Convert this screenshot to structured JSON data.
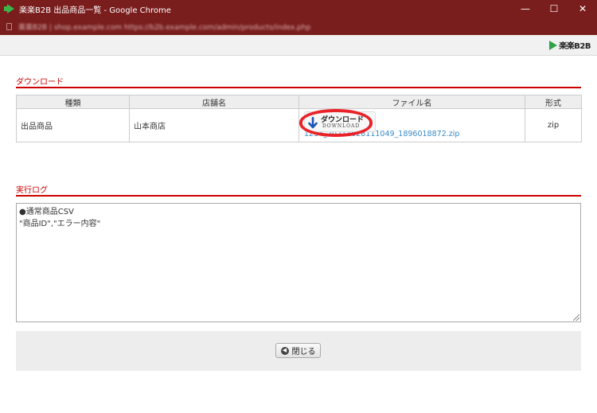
{
  "window": {
    "title": "楽楽B2B 出品商品一覧 - Google Chrome",
    "controls": {
      "minimize": "—",
      "maximize": "☐",
      "close": "✕"
    }
  },
  "addressbar": {
    "url": "楽楽B2B | shop.example.com   https://b2b.example.com/admin/products/index.php"
  },
  "brand": {
    "logo_text": "楽楽B2B"
  },
  "download_section": {
    "title": "ダウンロード",
    "columns": [
      "種類",
      "店舗名",
      "ファイル名",
      "形式"
    ],
    "rows": [
      {
        "type": "出品商品",
        "store": "山本商店",
        "button_label": "ダウンロード",
        "button_sublabel": "DOWNLOAD",
        "filename": "1234_20211028111049_1896018872.zip",
        "format": "zip"
      }
    ]
  },
  "log_section": {
    "title": "実行ログ",
    "lines": [
      "●通常商品CSV",
      "\"商品ID\",\"エラー内容\""
    ]
  },
  "footer": {
    "close_label": "閉じる"
  },
  "colors": {
    "accent": "#cc0000",
    "titlebar": "#7a1d1d",
    "link": "#3a8bc8",
    "highlight": "#e8232a"
  },
  "icons": {
    "app": "rakuraku-logo-icon",
    "download": "download-arrow-icon",
    "close": "back-circle-icon"
  }
}
